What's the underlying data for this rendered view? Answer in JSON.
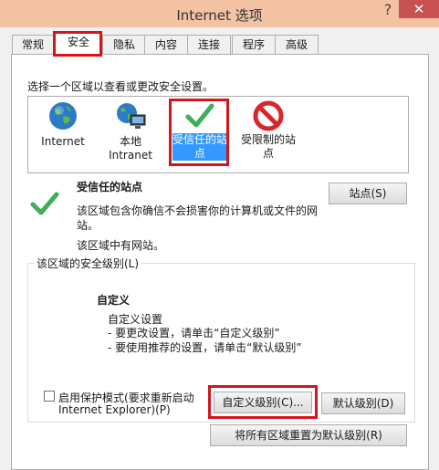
{
  "window": {
    "title": "Internet 选项",
    "help": "?",
    "close": "✕"
  },
  "tabs": [
    {
      "label": "常规"
    },
    {
      "label": "安全"
    },
    {
      "label": "隐私"
    },
    {
      "label": "内容"
    },
    {
      "label": "连接"
    },
    {
      "label": "程序"
    },
    {
      "label": "高级"
    }
  ],
  "zones": {
    "heading": "选择一个区域以查看或更改安全设置。",
    "items": [
      {
        "line1": "Internet",
        "line2": "",
        "icon": "globe-icon"
      },
      {
        "line1": "本地",
        "line2": "Intranet",
        "icon": "local-intranet-icon"
      },
      {
        "line1": "受信任的站",
        "line2": "点",
        "icon": "checkmark-icon"
      },
      {
        "line1": "受限制的站",
        "line2": "点",
        "icon": "restricted-icon"
      }
    ]
  },
  "zone_info": {
    "title": "受信任的站点",
    "desc1": "该区域包含你确信不会损害你的计算机或文件的网",
    "desc2": "站。",
    "status": "该区域中有网站。",
    "sites_button": "站点(S)"
  },
  "security_level": {
    "legend": "该区域的安全级别(L)",
    "level_name": "自定义",
    "custom_label": "自定义设置",
    "tip1": "- 要更改设置，请单击“自定义级别”",
    "tip2": "- 要使用推荐的设置，请单击“默认级别”",
    "protected_mode_line1": "启用保护模式(要求重新启动",
    "protected_mode_line2": "Internet Explorer)(P)",
    "custom_level_button": "自定义级别(C)...",
    "default_level_button": "默认级别(D)"
  },
  "reset_all_button": "将所有区域重置为默认级别(R)",
  "colors": {
    "titlebar": "#f2c2a3",
    "close": "#c75050",
    "selection": "#3399ff",
    "highlight": "#d7141a",
    "check": "#3fae5a"
  }
}
